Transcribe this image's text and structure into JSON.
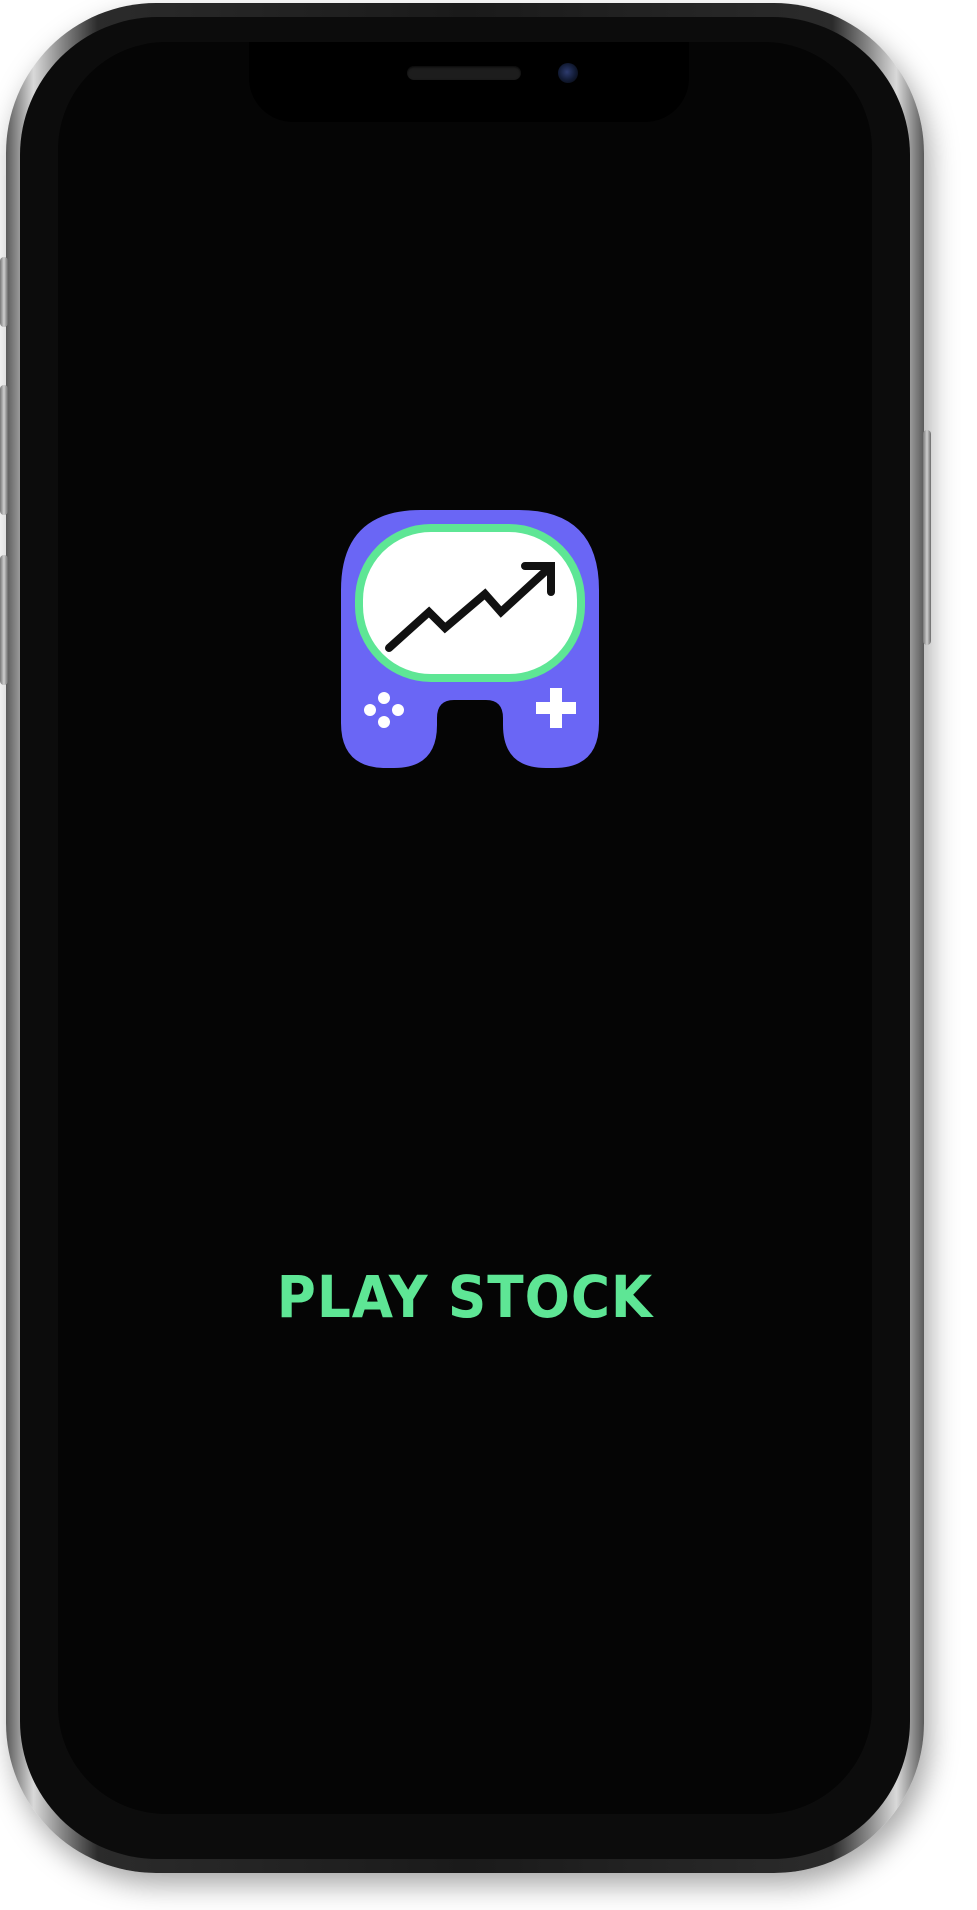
{
  "app": {
    "name": "PLAY STOCK"
  },
  "colors": {
    "background": "#050505",
    "brand_purple": "#6a66f5",
    "brand_green": "#5ee695",
    "screen_white": "#ffffff",
    "chart_line": "#111111"
  },
  "icons": {
    "logo": "gamepad-stock-chart-logo"
  }
}
